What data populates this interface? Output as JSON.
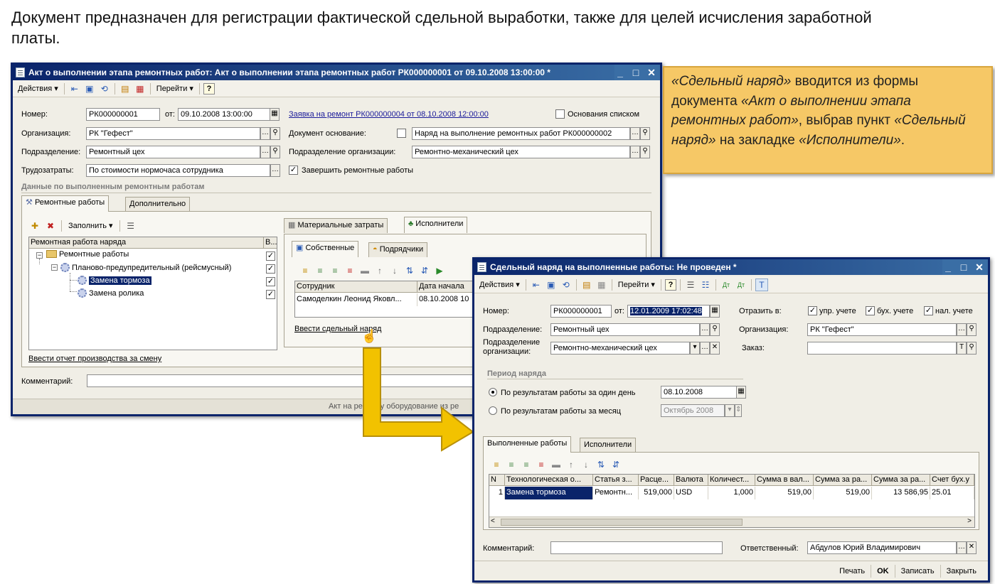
{
  "caption": "Документ предназначен для регистрации фактической сдельной выработки, также для целей исчисления заработной платы.",
  "callout": {
    "p1": "«Сдельный наряд»",
    "p2": " вводится из формы документа ",
    "p3": "«Акт о выполнении этапа ремонтных работ»",
    "p4": ", выбрав пункт ",
    "p5": "«Сдельный наряд»",
    "p6": " на закладке ",
    "p7": "«Исполнители»",
    "p8": "."
  },
  "win1": {
    "title": "Акт о выполнении этапа ремонтных работ: Акт о выполнении этапа ремонтных работ РК000000001 от 09.10.2008 13:00:00 *",
    "toolbar": {
      "actions": "Действия ▾",
      "goto": "Перейти ▾"
    },
    "number_label": "Номер:",
    "number_value": "РК000000001",
    "date_label": "от:",
    "date_value": "09.10.2008 13:00:00",
    "request_link": "Заявка на ремонт РК000000004 от 08.10.2008 12:00:00",
    "base_list_label": "Основания списком",
    "org_label": "Организация:",
    "org_value": "РК \"Гефест\"",
    "base_doc_label": "Документ основание:",
    "base_doc_value": "Наряд на выполнение ремонтных работ РК000000002",
    "dept_label": "Подразделение:",
    "dept_value": "Ремонтный цех",
    "org_dept_label": "Подразделение организации:",
    "org_dept_value": "Ремонтно-механический цех",
    "labor_label": "Трудозатраты:",
    "labor_value": "По стоимости нормочаса сотрудника",
    "finish_label": "Завершить ремонтные работы",
    "section_title": "Данные по выполненным ремонтным работам",
    "tabs": [
      "Ремонтные работы",
      "Дополнительно"
    ],
    "fill_label": "Заполнить ▾",
    "tree_header": [
      "Ремонтная работа наряда",
      "В..."
    ],
    "tree_items": [
      "Ремонтные работы",
      "Планово-предупредительный (рейсмусный)",
      "Замена тормоза",
      "Замена ролика"
    ],
    "inner_tabs": [
      "Материальные затраты",
      "Исполнители"
    ],
    "sub_tabs": [
      "Собственные",
      "Подрядчики"
    ],
    "exec_header": [
      "Сотрудник",
      "Дата начала"
    ],
    "exec_row": [
      "Самоделкин Леонид Яковл...",
      "08.10.2008 10"
    ],
    "piecework_link": "Ввести сдельный наряд",
    "shift_link": "Ввести отчет производства за смену",
    "comment_label": "Комментарий:",
    "status_text": "Акт на ремонту оборудование из ре"
  },
  "win2": {
    "title": "Сдельный наряд на выполненные работы: Не проведен *",
    "toolbar": {
      "actions": "Действия ▾",
      "goto": "Перейти ▾"
    },
    "number_label": "Номер:",
    "number_value": "РК000000001",
    "date_label": "от:",
    "date_value": "12.01.2009 17:02:48",
    "reflect_label": "Отразить в:",
    "reflect": [
      "упр. учете",
      "бух. учете",
      "нал. учете"
    ],
    "dept_label": "Подразделение:",
    "dept_value": "Ремонтный цех",
    "org_label": "Организация:",
    "org_value": "РК \"Гефест\"",
    "org_dept_label": "Подразделение организации:",
    "org_dept_value": "Ремонтно-механический цех",
    "order_label": "Заказ:",
    "order_value": "",
    "period_title": "Период наряда",
    "radio_day": "По результатам работы за один день",
    "radio_day_value": "08.10.2008",
    "radio_month": "По результатам работы за месяц",
    "radio_month_value": "Октябрь 2008",
    "tabs": [
      "Выполненные работы",
      "Исполнители"
    ],
    "grid_headers": [
      "N",
      "Технологическая о...",
      "Статья з...",
      "Расце...",
      "Валюта",
      "Количест...",
      "Сумма в вал...",
      "Сумма за ра...",
      "Сумма за ра...",
      "Счет бух.у"
    ],
    "grid_row": [
      "1",
      "Замена тормоза",
      "Ремонтн...",
      "519,000",
      "USD",
      "1,000",
      "519,00",
      "519,00",
      "13 586,95",
      "25.01"
    ],
    "comment_label": "Комментарий:",
    "comment_value": "",
    "resp_label": "Ответственный:",
    "resp_value": "Абдулов Юрий Владимирович",
    "buttons": [
      "Печать",
      "OK",
      "Записать",
      "Закрыть"
    ]
  },
  "colors": {
    "titlebar": "#0a246a",
    "callout": "#f6c866",
    "arrow": "#f2c200"
  }
}
